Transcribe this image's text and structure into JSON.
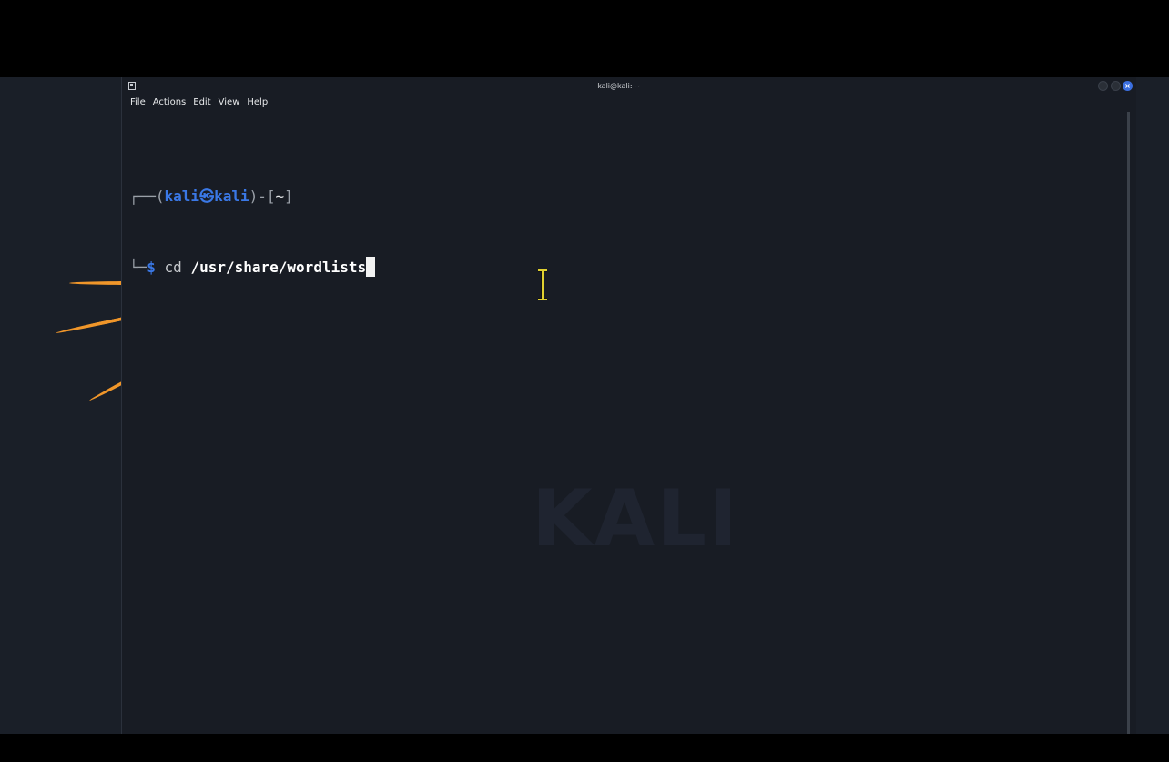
{
  "window": {
    "title": "kali@kali: ~",
    "close_glyph": "×"
  },
  "menu": {
    "file": "File",
    "actions": "Actions",
    "edit": "Edit",
    "view": "View",
    "help": "Help"
  },
  "terminal": {
    "prompt": {
      "line1_open": "┌──(",
      "user": "kali",
      "at_symbol": "㉿",
      "host": "kali",
      "line1_mid": ")-[",
      "cwd": "~",
      "line1_close": "]",
      "line2_prefix": "└─",
      "dollar": "$"
    },
    "command": "cd",
    "argument": "/usr/share/wordlists"
  },
  "desktop": {
    "watermark_text": "KALI"
  },
  "colors": {
    "prompt_blue": "#3a78e6",
    "terminal_bg": "#181c24",
    "close_button": "#3b6fe0",
    "dragon_orange": "#f0962a",
    "ibeam_cursor": "#e0d030"
  },
  "icons": [
    "terminal-window-icon",
    "close-icon",
    "ibeam-cursor-icon"
  ]
}
